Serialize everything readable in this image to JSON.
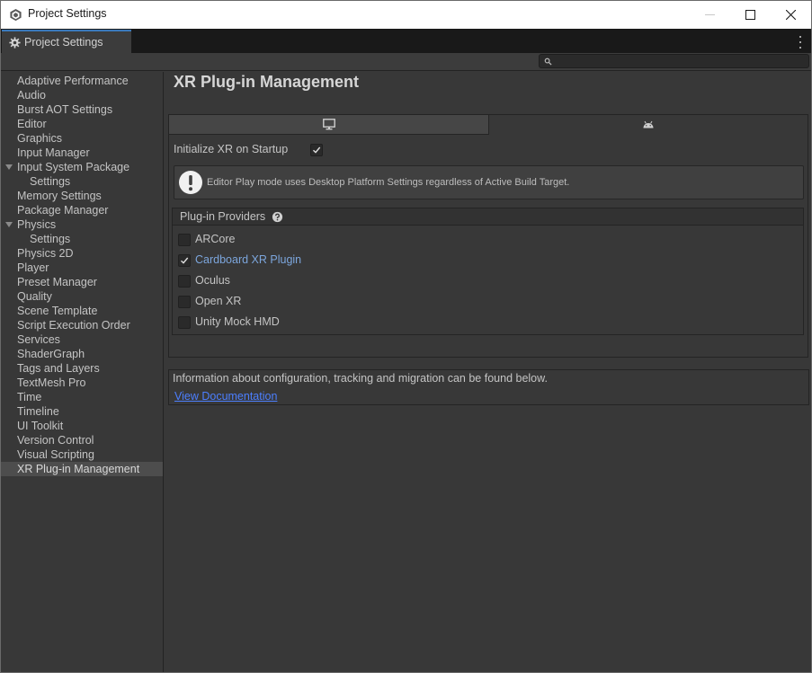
{
  "window": {
    "title": "Project Settings",
    "controls": [
      "minimize",
      "maximize",
      "close"
    ]
  },
  "tab": {
    "label": "Project Settings",
    "icon": "gear-icon"
  },
  "search": {
    "value": "",
    "placeholder": ""
  },
  "sidebar": {
    "items": [
      {
        "label": "Adaptive Performance",
        "level": 0
      },
      {
        "label": "Audio",
        "level": 0
      },
      {
        "label": "Burst AOT Settings",
        "level": 0
      },
      {
        "label": "Editor",
        "level": 0
      },
      {
        "label": "Graphics",
        "level": 0
      },
      {
        "label": "Input Manager",
        "level": 0
      },
      {
        "label": "Input System Package",
        "level": 0,
        "expanded": true
      },
      {
        "label": "Settings",
        "level": 1
      },
      {
        "label": "Memory Settings",
        "level": 0
      },
      {
        "label": "Package Manager",
        "level": 0
      },
      {
        "label": "Physics",
        "level": 0,
        "expanded": true
      },
      {
        "label": "Settings",
        "level": 1
      },
      {
        "label": "Physics 2D",
        "level": 0
      },
      {
        "label": "Player",
        "level": 0
      },
      {
        "label": "Preset Manager",
        "level": 0
      },
      {
        "label": "Quality",
        "level": 0
      },
      {
        "label": "Scene Template",
        "level": 0
      },
      {
        "label": "Script Execution Order",
        "level": 0
      },
      {
        "label": "Services",
        "level": 0
      },
      {
        "label": "ShaderGraph",
        "level": 0
      },
      {
        "label": "Tags and Layers",
        "level": 0
      },
      {
        "label": "TextMesh Pro",
        "level": 0
      },
      {
        "label": "Time",
        "level": 0
      },
      {
        "label": "Timeline",
        "level": 0
      },
      {
        "label": "UI Toolkit",
        "level": 0
      },
      {
        "label": "Version Control",
        "level": 0
      },
      {
        "label": "Visual Scripting",
        "level": 0
      },
      {
        "label": "XR Plug-in Management",
        "level": 0,
        "selected": true
      }
    ]
  },
  "main": {
    "title": "XR Plug-in Management",
    "platform_tabs": [
      {
        "icon": "monitor-icon",
        "selected": false
      },
      {
        "icon": "android-icon",
        "selected": true
      }
    ],
    "init_xr": {
      "label": "Initialize XR on Startup",
      "checked": true
    },
    "help_message": "Editor Play mode uses Desktop Platform Settings regardless of Active Build Target.",
    "providers": {
      "title": "Plug-in Providers",
      "items": [
        {
          "label": "ARCore",
          "checked": false
        },
        {
          "label": "Cardboard XR Plugin",
          "checked": true
        },
        {
          "label": "Oculus",
          "checked": false
        },
        {
          "label": "Open XR",
          "checked": false
        },
        {
          "label": "Unity Mock HMD",
          "checked": false
        }
      ]
    },
    "info": {
      "text": "Information about configuration, tracking and migration can be found below.",
      "link": "View Documentation"
    }
  },
  "colors": {
    "background": "#383838",
    "accent_tab": "#3a79bb",
    "link": "#4c7fff",
    "active_provider": "#7ca6dd"
  }
}
